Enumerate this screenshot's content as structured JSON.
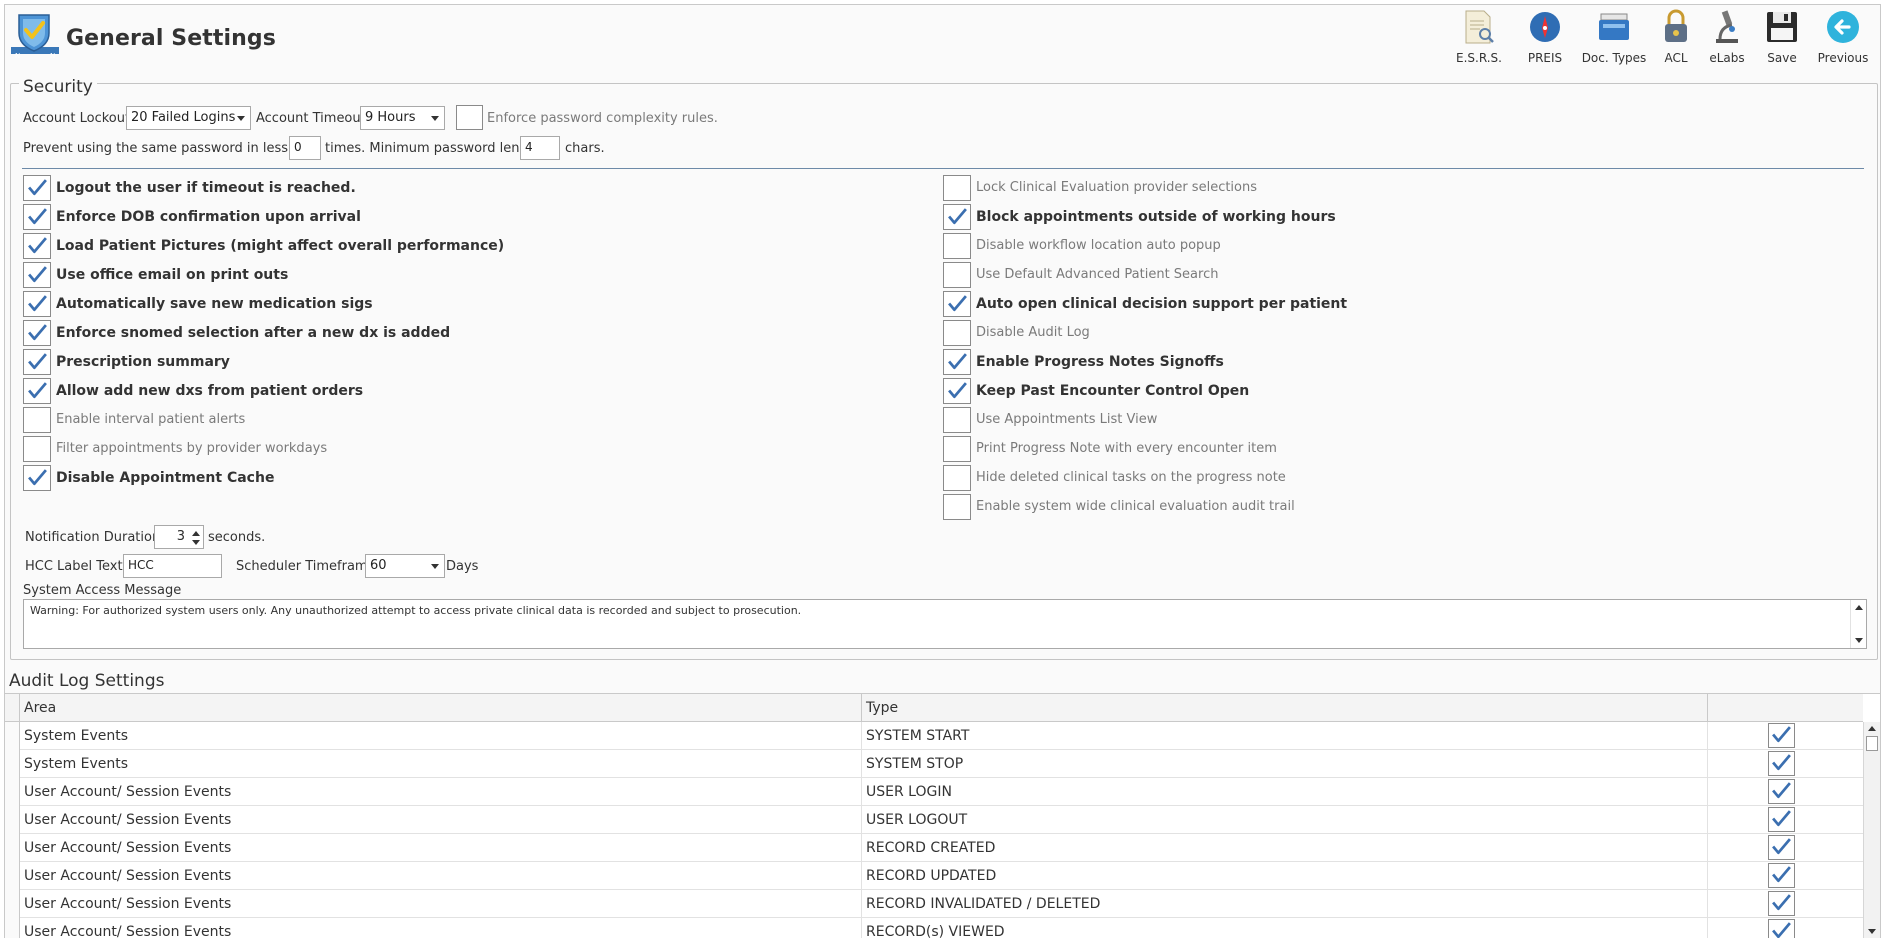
{
  "app": {
    "title": "General Settings"
  },
  "toolbar": [
    {
      "label": "E.S.R.S.",
      "icon": "document-search-icon"
    },
    {
      "label": "PREIS",
      "icon": "preis-icon"
    },
    {
      "label": "Doc. Types",
      "icon": "doc-types-icon"
    },
    {
      "label": "ACL",
      "icon": "lock-icon"
    },
    {
      "label": "eLabs",
      "icon": "microscope-icon"
    },
    {
      "label": "Save",
      "icon": "floppy-disk-icon"
    },
    {
      "label": "Previous",
      "icon": "back-arrow-icon"
    }
  ],
  "security": {
    "legend": "Security",
    "account_lockout_label": "Account Lockout",
    "account_lockout_value": "20 Failed Logins",
    "account_timeout_label": "Account Timeout",
    "account_timeout_value": "9 Hours",
    "complexity_label": "Enforce password complexity rules.",
    "complexity_checked": false,
    "reuse_prefix": "Prevent using the same password in less than",
    "reuse_value": "0",
    "reuse_suffix": "times. Minimum password length:",
    "min_length_value": "4",
    "min_length_suffix": "chars.",
    "left_options": [
      {
        "label": "Logout the user if timeout is reached.",
        "checked": true
      },
      {
        "label": "Enforce DOB confirmation upon arrival",
        "checked": true
      },
      {
        "label": "Load Patient Pictures (might affect overall performance)",
        "checked": true
      },
      {
        "label": "Use office email on print outs",
        "checked": true
      },
      {
        "label": "Automatically save new medication sigs",
        "checked": true
      },
      {
        "label": "Enforce snomed selection after a new dx is added",
        "checked": true
      },
      {
        "label": "Prescription summary",
        "checked": true
      },
      {
        "label": "Allow add new dxs from patient orders",
        "checked": true
      },
      {
        "label": "Enable interval patient alerts",
        "checked": false
      },
      {
        "label": "Filter appointments by provider workdays",
        "checked": false
      },
      {
        "label": "Disable Appointment Cache",
        "checked": true
      }
    ],
    "right_options": [
      {
        "label": "Lock Clinical Evaluation provider selections",
        "checked": false
      },
      {
        "label": "Block appointments outside of working hours",
        "checked": true
      },
      {
        "label": "Disable workflow location auto popup",
        "checked": false
      },
      {
        "label": "Use Default Advanced Patient Search",
        "checked": false
      },
      {
        "label": "Auto open clinical decision support per patient",
        "checked": true
      },
      {
        "label": "Disable Audit Log",
        "checked": false
      },
      {
        "label": "Enable Progress Notes Signoffs",
        "checked": true
      },
      {
        "label": "Keep Past Encounter Control Open",
        "checked": true
      },
      {
        "label": "Use Appointments List View",
        "checked": false
      },
      {
        "label": "Print Progress Note with every encounter item",
        "checked": false
      },
      {
        "label": "Hide deleted clinical tasks on the progress note",
        "checked": false
      },
      {
        "label": "Enable system wide clinical evaluation audit trail",
        "checked": false
      }
    ],
    "notification_label": "Notification Duration",
    "notification_value": "3",
    "notification_suffix": "seconds.",
    "hcc_label": "HCC Label Text:",
    "hcc_value": "HCC",
    "scheduler_label": "Scheduler Timeframe",
    "scheduler_value": "60",
    "scheduler_suffix": "Days",
    "access_message_label": "System Access Message",
    "access_message": "Warning: For authorized system users only. Any unauthorized attempt to access private clinical data is recorded and subject to prosecution."
  },
  "audit": {
    "title": "Audit Log Settings",
    "columns": [
      "Area",
      "Type",
      ""
    ],
    "rows": [
      {
        "area": "System Events",
        "type": "SYSTEM START",
        "checked": true
      },
      {
        "area": "System Events",
        "type": "SYSTEM STOP",
        "checked": true
      },
      {
        "area": "User Account/ Session Events",
        "type": "USER LOGIN",
        "checked": true
      },
      {
        "area": "User Account/ Session Events",
        "type": "USER LOGOUT",
        "checked": true
      },
      {
        "area": "User Account/ Session Events",
        "type": "RECORD CREATED",
        "checked": true
      },
      {
        "area": "User Account/ Session Events",
        "type": "RECORD UPDATED",
        "checked": true
      },
      {
        "area": "User Account/ Session Events",
        "type": "RECORD INVALIDATED / DELETED",
        "checked": true
      },
      {
        "area": "User Account/ Session Events",
        "type": "RECORD(s) VIEWED",
        "checked": true
      }
    ]
  },
  "colors": {
    "check": "#3b6fb0",
    "accent": "#6d8aa8"
  }
}
